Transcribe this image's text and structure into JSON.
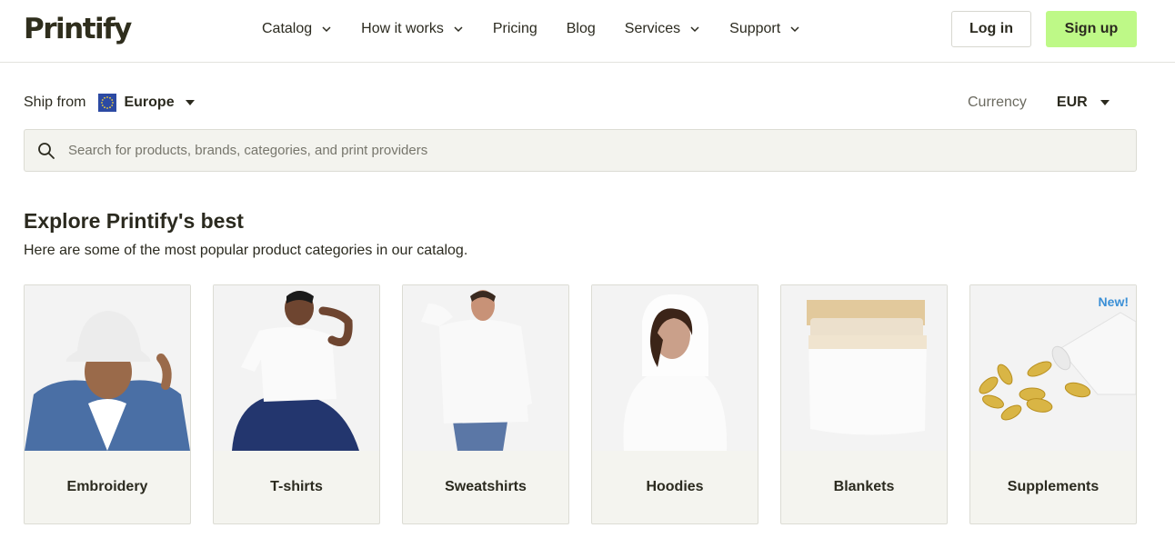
{
  "header": {
    "logo": "Printify",
    "nav": [
      {
        "label": "Catalog",
        "dropdown": true
      },
      {
        "label": "How it works",
        "dropdown": true
      },
      {
        "label": "Pricing",
        "dropdown": false
      },
      {
        "label": "Blog",
        "dropdown": false
      },
      {
        "label": "Services",
        "dropdown": true
      },
      {
        "label": "Support",
        "dropdown": true
      }
    ],
    "login_label": "Log in",
    "signup_label": "Sign up"
  },
  "ship": {
    "label": "Ship from",
    "value": "Europe"
  },
  "currency": {
    "label": "Currency",
    "value": "EUR"
  },
  "search": {
    "placeholder": "Search for products, brands, categories, and print providers"
  },
  "section": {
    "title": "Explore Printify's best",
    "subtitle": "Here are some of the most popular product categories in our catalog."
  },
  "categories": [
    {
      "label": "Embroidery",
      "image": "embroidery-bucket-hat-photo"
    },
    {
      "label": "T-shirts",
      "image": "tshirt-model-photo"
    },
    {
      "label": "Sweatshirts",
      "image": "sweatshirt-model-photo"
    },
    {
      "label": "Hoodies",
      "image": "hoodie-model-photo"
    },
    {
      "label": "Blankets",
      "image": "blanket-bed-photo"
    },
    {
      "label": "Supplements",
      "image": "supplement-capsules-photo",
      "badge": "New!"
    }
  ],
  "colors": {
    "accent": "#bef987",
    "text": "#2b2a1f",
    "badge": "#3a8fd6",
    "card_bg": "#f4f4ef"
  }
}
